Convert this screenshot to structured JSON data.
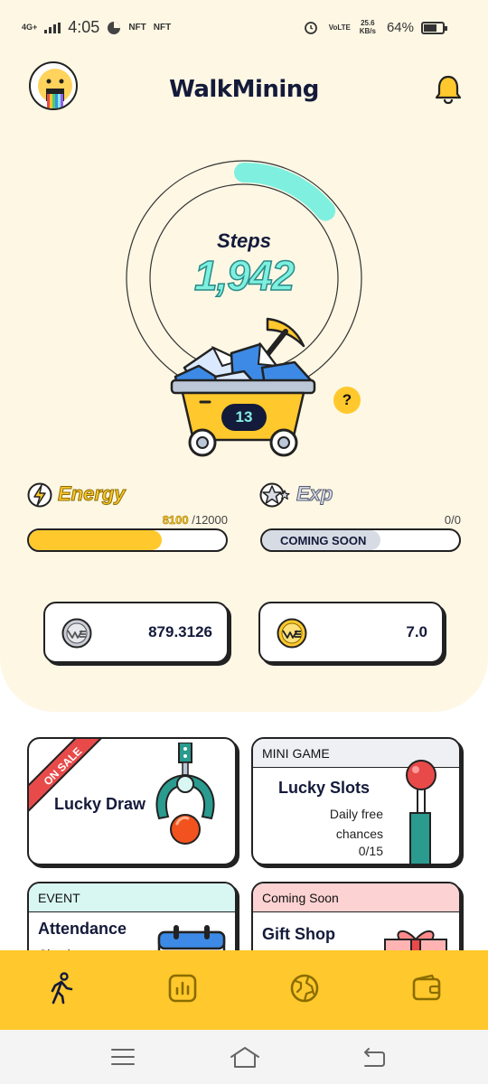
{
  "status_bar": {
    "network": "4G+",
    "time": "4:05",
    "nft_1": "NFT",
    "nft_2": "NFT",
    "volte": "VoLTE",
    "speed": "25.6",
    "speed_unit": "KB/s",
    "battery": "64%"
  },
  "header": {
    "title": "WalkMining",
    "avatar_icon": "avatar-face-icon",
    "notification_icon": "bell-icon"
  },
  "steps": {
    "label": "Steps",
    "value": "1,942",
    "ring_progress": 0.14
  },
  "cart": {
    "count": "13",
    "help": "?"
  },
  "energy": {
    "label": "Energy",
    "current": "8100",
    "max": "/12000",
    "fill": 0.675
  },
  "exp": {
    "label": "Exp",
    "value": "0/0",
    "bar_text": "COMING SOON",
    "fill": 0.6
  },
  "balances": [
    {
      "coin_icon": "silver-we-coin-icon",
      "value": "879.3126"
    },
    {
      "coin_icon": "gold-we-coin-icon",
      "value": "7.0"
    }
  ],
  "cards": {
    "lucky_draw": {
      "ribbon": "ON SALE",
      "title": "Lucky Draw"
    },
    "mini_game": {
      "header": "MINI GAME",
      "title": "Lucky Slots",
      "subtitle": "Daily free chances",
      "count": "0/15"
    },
    "event": {
      "header": "EVENT",
      "title": "Attendance",
      "subtitle": "Check"
    },
    "gift_shop": {
      "header": "Coming Soon",
      "title": "Gift Shop"
    }
  },
  "bottom_nav": [
    {
      "icon": "walk-icon",
      "active": true
    },
    {
      "icon": "stats-icon",
      "active": false
    },
    {
      "icon": "globe-icon",
      "active": false
    },
    {
      "icon": "wallet-icon",
      "active": false
    }
  ],
  "colors": {
    "background": "#fdf7e4",
    "accent_yellow": "#ffc82c",
    "accent_teal": "#7ff0e0",
    "navy": "#141a3a",
    "sale_red": "#e84a4a"
  }
}
